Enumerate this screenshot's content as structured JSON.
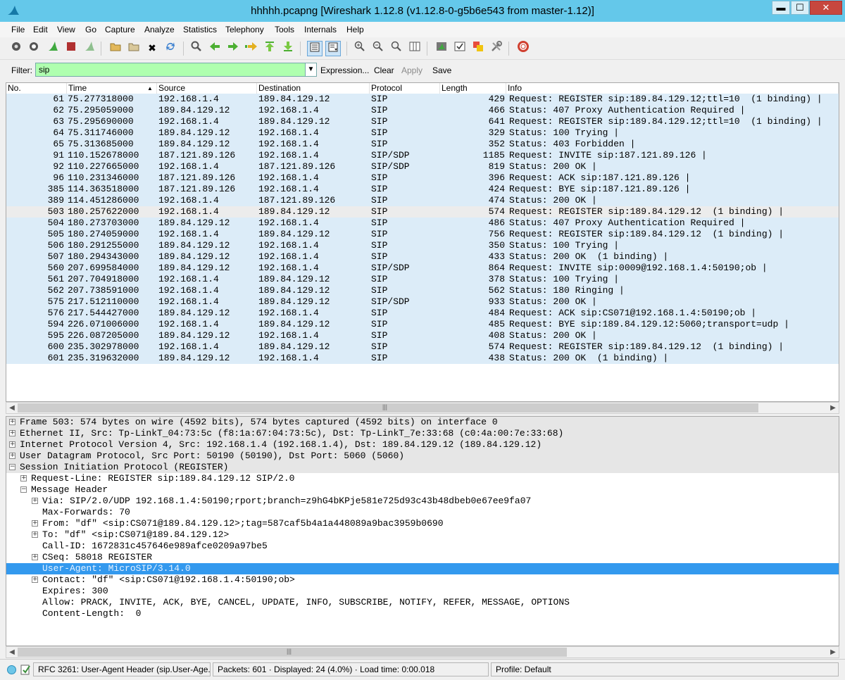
{
  "window": {
    "title": "hhhhh.pcapng   [Wireshark 1.12.8  (v1.12.8-0-g5b6e543 from master-1.12)]",
    "minimize": "▬",
    "maximize": "☐",
    "close": "✕"
  },
  "menu": [
    "File",
    "Edit",
    "View",
    "Go",
    "Capture",
    "Analyze",
    "Statistics",
    "Telephony",
    "Tools",
    "Internals",
    "Help"
  ],
  "toolbar_icons": [
    "interface-list-icon",
    "capture-options-icon",
    "start-capture-icon",
    "stop-capture-icon",
    "restart-capture-icon",
    "open-file-icon",
    "save-file-icon",
    "close-file-icon",
    "reload-icon",
    "find-packet-icon",
    "go-back-icon",
    "go-forward-icon",
    "go-to-packet-icon",
    "first-packet-icon",
    "last-packet-icon",
    "colorize-icon",
    "auto-scroll-icon",
    "zoom-in-icon",
    "zoom-out-icon",
    "normal-size-icon",
    "resize-columns-icon",
    "capture-filters-icon",
    "display-filters-icon",
    "coloring-rules-icon",
    "preferences-icon",
    "help-icon"
  ],
  "filter": {
    "label": "Filter:",
    "value": "sip",
    "expression": "Expression...",
    "clear": "Clear",
    "apply": "Apply",
    "save": "Save"
  },
  "packet_list": {
    "columns": [
      "No.",
      "Time",
      "Source",
      "Destination",
      "Protocol",
      "Length",
      "Info"
    ],
    "rows": [
      {
        "no": "61",
        "time": "75.277318000",
        "src": "192.168.1.4",
        "dst": "189.84.129.12",
        "proto": "SIP",
        "len": "429",
        "info": "Request: REGISTER sip:189.84.129.12;ttl=10  (1 binding) |"
      },
      {
        "no": "62",
        "time": "75.295059000",
        "src": "189.84.129.12",
        "dst": "192.168.1.4",
        "proto": "SIP",
        "len": "466",
        "info": "Status: 407 Proxy Authentication Required |"
      },
      {
        "no": "63",
        "time": "75.295690000",
        "src": "192.168.1.4",
        "dst": "189.84.129.12",
        "proto": "SIP",
        "len": "641",
        "info": "Request: REGISTER sip:189.84.129.12;ttl=10  (1 binding) |"
      },
      {
        "no": "64",
        "time": "75.311746000",
        "src": "189.84.129.12",
        "dst": "192.168.1.4",
        "proto": "SIP",
        "len": "329",
        "info": "Status: 100 Trying |"
      },
      {
        "no": "65",
        "time": "75.313685000",
        "src": "189.84.129.12",
        "dst": "192.168.1.4",
        "proto": "SIP",
        "len": "352",
        "info": "Status: 403 Forbidden |"
      },
      {
        "no": "91",
        "time": "110.152678000",
        "src": "187.121.89.126",
        "dst": "192.168.1.4",
        "proto": "SIP/SDP",
        "len": "1185",
        "info": "Request: INVITE sip:187.121.89.126 |"
      },
      {
        "no": "92",
        "time": "110.227665000",
        "src": "192.168.1.4",
        "dst": "187.121.89.126",
        "proto": "SIP/SDP",
        "len": "819",
        "info": "Status: 200 OK |"
      },
      {
        "no": "96",
        "time": "110.231346000",
        "src": "187.121.89.126",
        "dst": "192.168.1.4",
        "proto": "SIP",
        "len": "396",
        "info": "Request: ACK sip:187.121.89.126 |"
      },
      {
        "no": "385",
        "time": "114.363518000",
        "src": "187.121.89.126",
        "dst": "192.168.1.4",
        "proto": "SIP",
        "len": "424",
        "info": "Request: BYE sip:187.121.89.126 |"
      },
      {
        "no": "389",
        "time": "114.451286000",
        "src": "192.168.1.4",
        "dst": "187.121.89.126",
        "proto": "SIP",
        "len": "474",
        "info": "Status: 200 OK |"
      },
      {
        "no": "503",
        "time": "180.257622000",
        "src": "192.168.1.4",
        "dst": "189.84.129.12",
        "proto": "SIP",
        "len": "574",
        "info": "Request: REGISTER sip:189.84.129.12  (1 binding) |"
      },
      {
        "no": "504",
        "time": "180.273703000",
        "src": "189.84.129.12",
        "dst": "192.168.1.4",
        "proto": "SIP",
        "len": "486",
        "info": "Status: 407 Proxy Authentication Required |"
      },
      {
        "no": "505",
        "time": "180.274059000",
        "src": "192.168.1.4",
        "dst": "189.84.129.12",
        "proto": "SIP",
        "len": "756",
        "info": "Request: REGISTER sip:189.84.129.12  (1 binding) |"
      },
      {
        "no": "506",
        "time": "180.291255000",
        "src": "189.84.129.12",
        "dst": "192.168.1.4",
        "proto": "SIP",
        "len": "350",
        "info": "Status: 100 Trying |"
      },
      {
        "no": "507",
        "time": "180.294343000",
        "src": "189.84.129.12",
        "dst": "192.168.1.4",
        "proto": "SIP",
        "len": "433",
        "info": "Status: 200 OK  (1 binding) |"
      },
      {
        "no": "560",
        "time": "207.699584000",
        "src": "189.84.129.12",
        "dst": "192.168.1.4",
        "proto": "SIP/SDP",
        "len": "864",
        "info": "Request: INVITE sip:0009@192.168.1.4:50190;ob |"
      },
      {
        "no": "561",
        "time": "207.704918000",
        "src": "192.168.1.4",
        "dst": "189.84.129.12",
        "proto": "SIP",
        "len": "378",
        "info": "Status: 100 Trying |"
      },
      {
        "no": "562",
        "time": "207.738591000",
        "src": "192.168.1.4",
        "dst": "189.84.129.12",
        "proto": "SIP",
        "len": "562",
        "info": "Status: 180 Ringing |"
      },
      {
        "no": "575",
        "time": "217.512110000",
        "src": "192.168.1.4",
        "dst": "189.84.129.12",
        "proto": "SIP/SDP",
        "len": "933",
        "info": "Status: 200 OK |"
      },
      {
        "no": "576",
        "time": "217.544427000",
        "src": "189.84.129.12",
        "dst": "192.168.1.4",
        "proto": "SIP",
        "len": "484",
        "info": "Request: ACK sip:CS071@192.168.1.4:50190;ob |"
      },
      {
        "no": "594",
        "time": "226.071006000",
        "src": "192.168.1.4",
        "dst": "189.84.129.12",
        "proto": "SIP",
        "len": "485",
        "info": "Request: BYE sip:189.84.129.12:5060;transport=udp |"
      },
      {
        "no": "595",
        "time": "226.087205000",
        "src": "189.84.129.12",
        "dst": "192.168.1.4",
        "proto": "SIP",
        "len": "408",
        "info": "Status: 200 OK |"
      },
      {
        "no": "600",
        "time": "235.302978000",
        "src": "192.168.1.4",
        "dst": "189.84.129.12",
        "proto": "SIP",
        "len": "574",
        "info": "Request: REGISTER sip:189.84.129.12  (1 binding) |"
      },
      {
        "no": "601",
        "time": "235.319632000",
        "src": "189.84.129.12",
        "dst": "192.168.1.4",
        "proto": "SIP",
        "len": "438",
        "info": "Status: 200 OK  (1 binding) |"
      }
    ],
    "selected_row_index": 10
  },
  "details": [
    {
      "text": "Frame 503: 574 bytes on wire (4592 bits), 574 bytes captured (4592 bits) on interface 0",
      "expander": "+",
      "level": 0
    },
    {
      "text": "Ethernet II, Src: Tp-LinkT_04:73:5c (f8:1a:67:04:73:5c), Dst: Tp-LinkT_7e:33:68 (c0:4a:00:7e:33:68)",
      "expander": "+",
      "level": 0
    },
    {
      "text": "Internet Protocol Version 4, Src: 192.168.1.4 (192.168.1.4), Dst: 189.84.129.12 (189.84.129.12)",
      "expander": "+",
      "level": 0
    },
    {
      "text": "User Datagram Protocol, Src Port: 50190 (50190), Dst Port: 5060 (5060)",
      "expander": "+",
      "level": 0
    },
    {
      "text": "Session Initiation Protocol (REGISTER)",
      "expander": "−",
      "level": 0
    },
    {
      "text": "Request-Line: REGISTER sip:189.84.129.12 SIP/2.0",
      "expander": "+",
      "level": 1
    },
    {
      "text": "Message Header",
      "expander": "−",
      "level": 1
    },
    {
      "text": "Via: SIP/2.0/UDP 192.168.1.4:50190;rport;branch=z9hG4bKPje581e725d93c43b48dbeb0e67ee9fa07",
      "expander": "+",
      "level": 2
    },
    {
      "text": "Max-Forwards: 70",
      "expander": "",
      "level": 2
    },
    {
      "text": "From: \"df\" <sip:CS071@189.84.129.12>;tag=587caf5b4a1a448089a9bac3959b0690",
      "expander": "+",
      "level": 2
    },
    {
      "text": "To: \"df\" <sip:CS071@189.84.129.12>",
      "expander": "+",
      "level": 2
    },
    {
      "text": "Call-ID: 1672831c457646e989afce0209a97be5",
      "expander": "",
      "level": 2
    },
    {
      "text": "CSeq: 58018 REGISTER",
      "expander": "+",
      "level": 2
    },
    {
      "text": "User-Agent: MicroSIP/3.14.0",
      "expander": "",
      "level": 2
    },
    {
      "text": "Contact: \"df\" <sip:CS071@192.168.1.4:50190;ob>",
      "expander": "+",
      "level": 2
    },
    {
      "text": "Expires: 300",
      "expander": "",
      "level": 2
    },
    {
      "text": "Allow: PRACK, INVITE, ACK, BYE, CANCEL, UPDATE, INFO, SUBSCRIBE, NOTIFY, REFER, MESSAGE, OPTIONS",
      "expander": "",
      "level": 2
    },
    {
      "text": "Content-Length:  0",
      "expander": "",
      "level": 2
    }
  ],
  "status": {
    "field": "RFC 3261: User-Agent Header (sip.User-Age...",
    "packets": "Packets: 601 · Displayed: 24 (4.0%) · Load time: 0:00.018",
    "profile": "Profile: Default"
  },
  "colors": {
    "titlebar": "#64c8ea",
    "row_bg": "#dcecf8",
    "selected_row": "#ececec",
    "filter_ok": "#afffaf",
    "detail_highlight": "#3399ee"
  }
}
